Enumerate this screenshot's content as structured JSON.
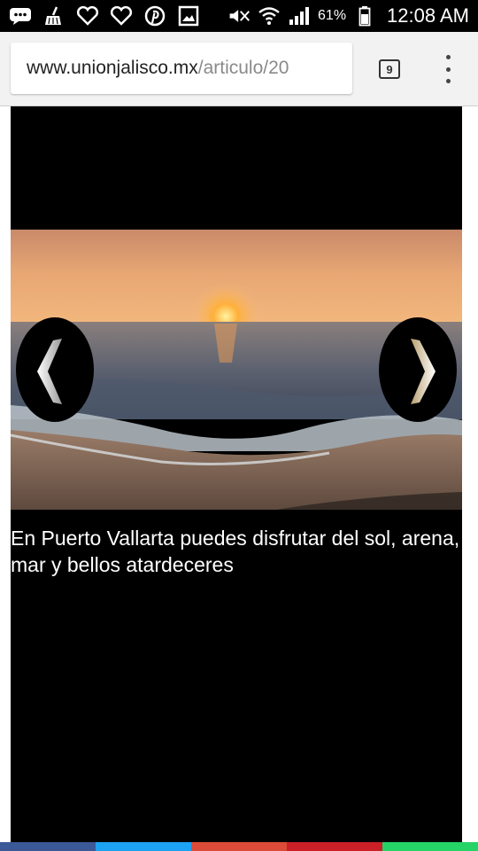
{
  "status_bar": {
    "battery": "61%",
    "time": "12:08 AM",
    "left_icons": [
      "messages-icon",
      "cleaner-icon",
      "heart-icon",
      "heart-icon",
      "pinterest-icon",
      "gallery-icon"
    ],
    "right_icons": [
      "mute-icon",
      "wifi-icon",
      "signal-icon",
      "battery-icon"
    ]
  },
  "browser": {
    "url_domain": "www.unionjalisco.mx",
    "url_path": "/articulo/20",
    "tab_count": "9"
  },
  "article": {
    "caption": "En Puerto Vallarta puedes disfrutar del sol, arena, mar y bellos atardeceres",
    "image_alt": "Sunset over the beach in Puerto Vallarta"
  },
  "colors": {
    "status_bg": "#000000",
    "toolbar_bg": "#f2f2f2",
    "article_bg": "#000000",
    "share_facebook": "#3b5998",
    "share_twitter": "#1da1f2",
    "share_google": "#dd4b39",
    "share_pinterest": "#cb2027",
    "share_whatsapp": "#25d366"
  }
}
